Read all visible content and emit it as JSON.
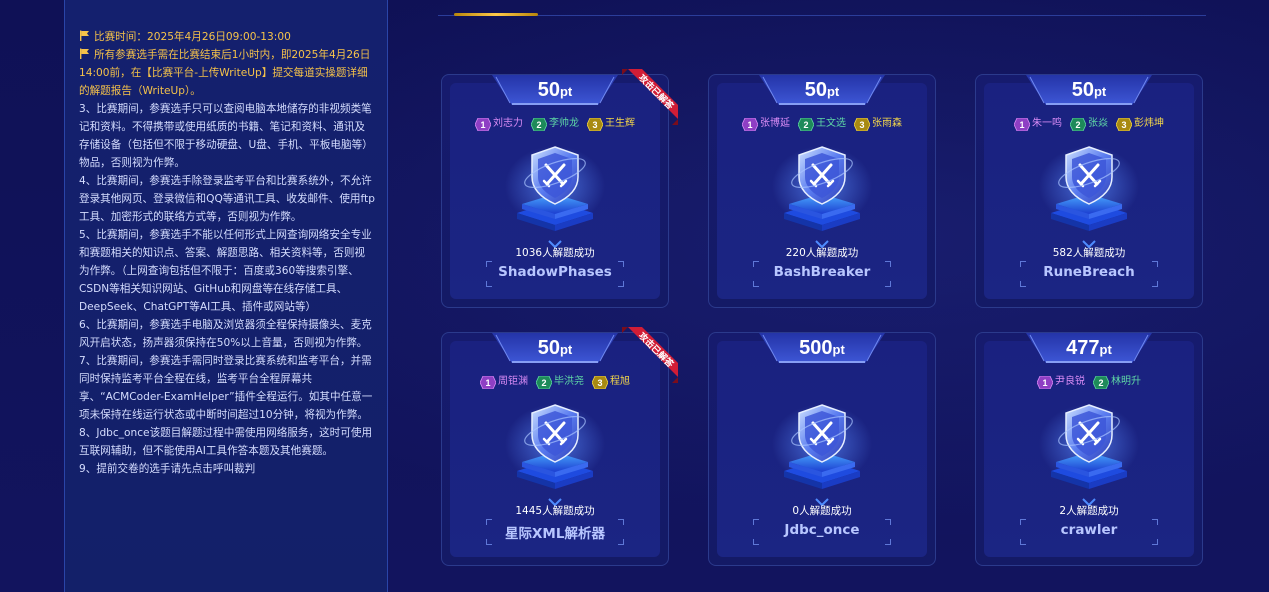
{
  "rules": {
    "lines": [
      {
        "text": "比赛时间：2025年4月26日09:00-13:00",
        "highlight": true,
        "flag": true
      },
      {
        "text": "所有参赛选手需在比赛结束后1小时内，即2025年4月26日14:00前，在【比赛平台-上传WriteUp】提交每道实操题详细的解题报告（WriteUp）。",
        "highlight": true,
        "flag": true
      },
      {
        "text": "3、比赛期间，参赛选手只可以查阅电脑本地储存的非视频类笔记和资料。不得携带或使用纸质的书籍、笔记和资料、通讯及存储设备（包括但不限于移动硬盘、U盘、手机、平板电脑等）物品，否则视为作弊。",
        "highlight": false
      },
      {
        "text": "4、比赛期间，参赛选手除登录监考平台和比赛系统外，不允许登录其他网页、登录微信和QQ等通讯工具、收发邮件、使用ftp工具、加密形式的联络方式等，否则视为作弊。",
        "highlight": false
      },
      {
        "text": "5、比赛期间，参赛选手不能以任何形式上网查询网络安全专业和赛题相关的知识点、答案、解题思路、相关资料等，否则视为作弊。（上网查询包括但不限于：百度或360等搜索引擎、CSDN等相关知识网站、GitHub和网盘等在线存储工具、DeepSeek、ChatGPT等AI工具、插件或网站等）",
        "highlight": false
      },
      {
        "text": "6、比赛期间，参赛选手电脑及浏览器须全程保持摄像头、麦克风开启状态，扬声器须保持在50%以上音量，否则视为作弊。",
        "highlight": false
      },
      {
        "text": "7、比赛期间，参赛选手需同时登录比赛系统和监考平台，并需同时保持监考平台全程在线，监考平台全程屏幕共享、“ACMCoder-ExamHelper”插件全程运行。如其中任意一项未保持在线运行状态或中断时间超过10分钟，将视为作弊。",
        "highlight": false
      },
      {
        "text": "8、Jdbc_once该题目解题过程中需使用网络服务，这时可使用互联网辅助，但不能使用AI工具作答本题及其他赛题。",
        "highlight": false
      },
      {
        "text": "9、提前交卷的选手请先点击呼叫裁判",
        "highlight": false
      }
    ]
  },
  "ribbon_label": "攻击已解答",
  "solved_suffix": "人解题成功",
  "colors": {
    "accent": "#ffc94a",
    "rank1": "#d98cf5",
    "rank2": "#5fd8a5",
    "rank3": "#f2d64a"
  },
  "challenges": [
    {
      "points": "50",
      "unit": "pt",
      "solvers": [
        "刘志力",
        "李帅龙",
        "王生辉"
      ],
      "solved": "1036人解题成功",
      "name": "ShadowPhases",
      "ribbon": true
    },
    {
      "points": "50",
      "unit": "pt",
      "solvers": [
        "张博延",
        "王文选",
        "张雨森"
      ],
      "solved": "220人解题成功",
      "name": "BashBreaker",
      "ribbon": false
    },
    {
      "points": "50",
      "unit": "pt",
      "solvers": [
        "朱一鸣",
        "张焱",
        "彭炜坤"
      ],
      "solved": "582人解题成功",
      "name": "RuneBreach",
      "ribbon": false
    },
    {
      "points": "50",
      "unit": "pt",
      "solvers": [
        "周钜渊",
        "毕洪尧",
        "程旭"
      ],
      "solved": "1445人解题成功",
      "name": "星际XML解析器",
      "ribbon": true
    },
    {
      "points": "500",
      "unit": "pt",
      "solvers": [],
      "solved": "0人解题成功",
      "name": "Jdbc_once",
      "ribbon": false
    },
    {
      "points": "477",
      "unit": "pt",
      "solvers": [
        "尹良锐",
        "林明升"
      ],
      "solved": "2人解题成功",
      "name": "crawler",
      "ribbon": false
    }
  ]
}
